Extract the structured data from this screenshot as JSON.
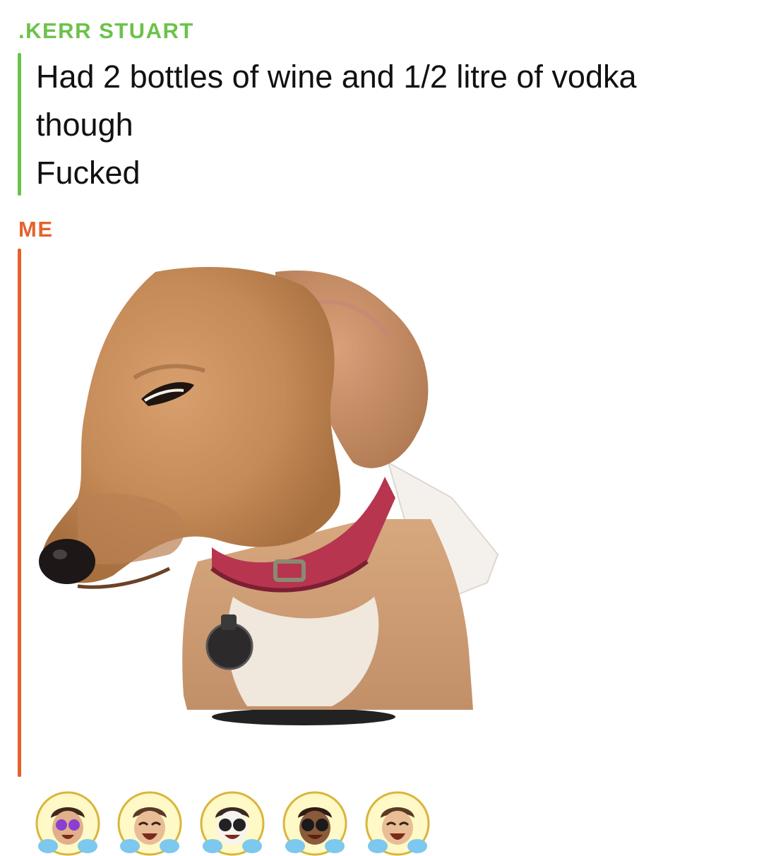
{
  "thread": {
    "friend": {
      "name": ".KERR STUART",
      "color": "#6cc24a",
      "message_lines": [
        "Had 2 bottles of wine and 1/2 litre of vodka",
        "though",
        "Fucked"
      ]
    },
    "me": {
      "name": "ME",
      "color": "#e4622e",
      "sticker_icon": "side-eye-dog-sticker"
    }
  },
  "reactions": [
    {
      "icon": "bitmoji-laughing-purple-glasses-icon",
      "lens": "#8a3fd1"
    },
    {
      "icon": "bitmoji-laughing-icon",
      "lens": "none"
    },
    {
      "icon": "bitmoji-laughing-white-face-sunglasses-icon",
      "lens": "#222222"
    },
    {
      "icon": "bitmoji-laughing-dark-sunglasses-icon",
      "lens": "#1a1a1a"
    },
    {
      "icon": "bitmoji-laughing-plain-icon",
      "lens": "none"
    }
  ]
}
